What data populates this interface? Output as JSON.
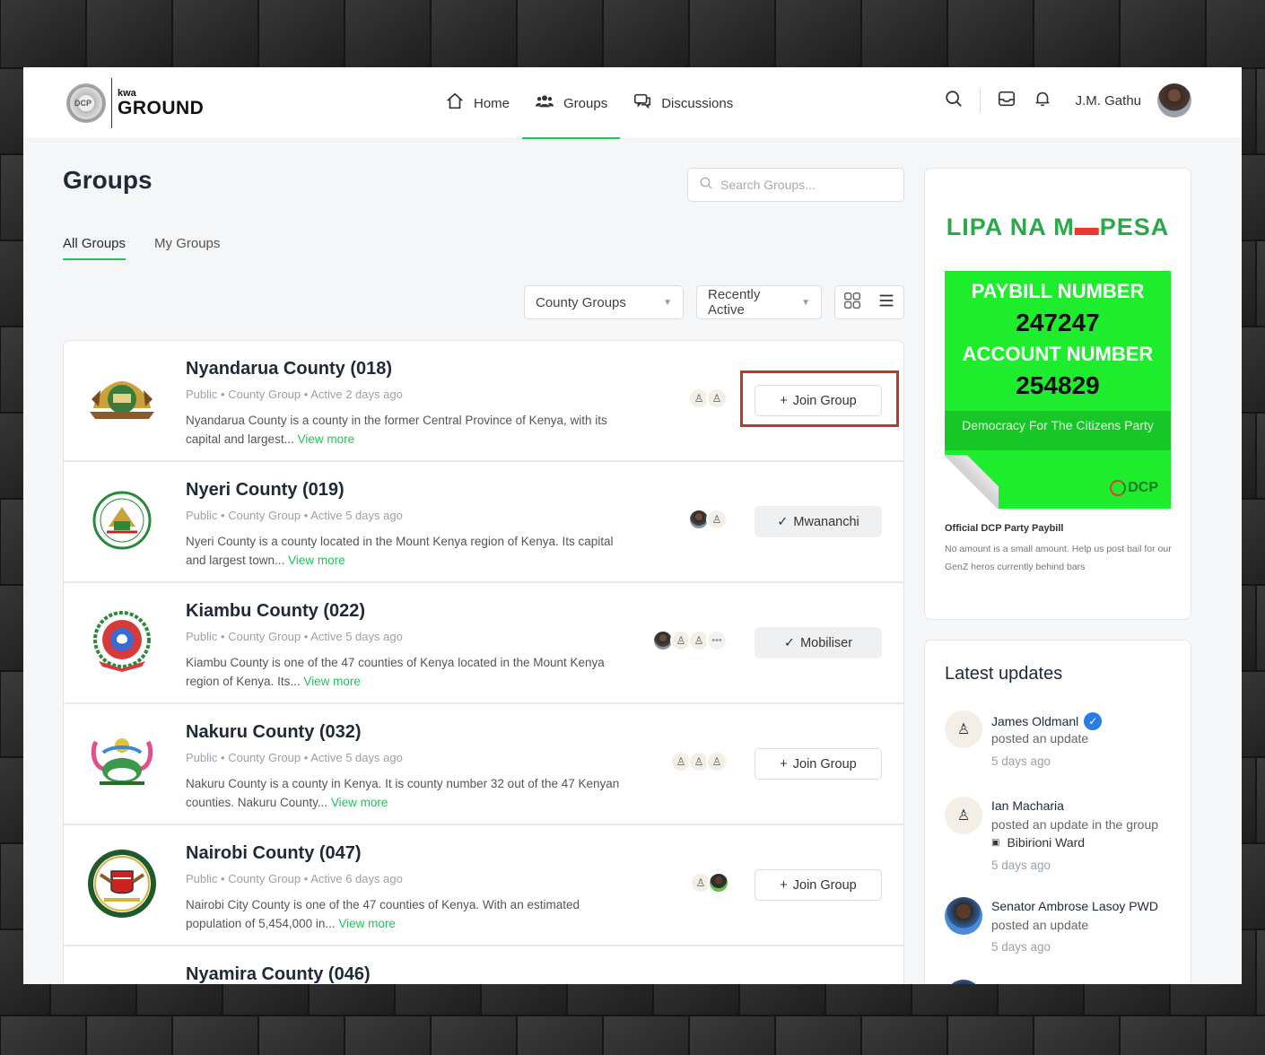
{
  "header": {
    "logo_kwa": "kwa",
    "logo_ground": "GROUND",
    "logo_seal": "DCP",
    "nav": [
      {
        "label": "Home",
        "icon": "home-icon"
      },
      {
        "label": "Groups",
        "icon": "users-icon"
      },
      {
        "label": "Discussions",
        "icon": "chat-icon"
      }
    ],
    "user_name": "J.M. Gathu"
  },
  "main": {
    "title": "Groups",
    "search_placeholder": "Search Groups...",
    "tabs": [
      "All Groups",
      "My Groups"
    ],
    "filter_type": "County Groups",
    "filter_sort": "Recently Active",
    "groups": [
      {
        "name": "Nyandarua County (018)",
        "visibility": "Public",
        "type": "County Group",
        "active": "Active 2 days ago",
        "desc": "Nyandarua County is a county in the former Central Province of Kenya, with its capital and largest...",
        "view_more": "View more",
        "action": "Join Group"
      },
      {
        "name": "Nyeri County (019)",
        "visibility": "Public",
        "type": "County Group",
        "active": "Active 5 days ago",
        "desc": "Nyeri County is a county located in the Mount Kenya region of Kenya. Its capital and largest town...",
        "view_more": "View more",
        "action": "Mwananchi"
      },
      {
        "name": "Kiambu County (022)",
        "visibility": "Public",
        "type": "County Group",
        "active": "Active 5 days ago",
        "desc": "Kiambu County is one of the 47 counties of Kenya located in the Mount Kenya region of Kenya. Its...",
        "view_more": "View more",
        "action": "Mobiliser"
      },
      {
        "name": "Nakuru County (032)",
        "visibility": "Public",
        "type": "County Group",
        "active": "Active 5 days ago",
        "desc": "Nakuru County is a county in Kenya. It is county number 32 out of the 47 Kenyan counties. Nakuru County...",
        "view_more": "View more",
        "action": "Join Group"
      },
      {
        "name": "Nairobi County (047)",
        "visibility": "Public",
        "type": "County Group",
        "active": "Active 6 days ago",
        "desc": "Nairobi City County is one of the 47 counties of Kenya. With an estimated population of 5,454,000 in...",
        "view_more": "View more",
        "action": "Join Group"
      },
      {
        "name": "Nyamira County (046)"
      }
    ]
  },
  "ad": {
    "title_left": "LIPA NA M",
    "title_right": "PESA",
    "paybill_label": "PAYBILL NUMBER",
    "paybill_number": "247247",
    "account_label": "ACCOUNT NUMBER",
    "account_number": "254829",
    "band_text": "Democracy For The Citizens Party",
    "brand": "DCP",
    "caption": "Official DCP Party Paybill",
    "note": "No amount is a small amount. Help us post bail for our GenZ heros currently behind bars"
  },
  "updates": {
    "title": "Latest updates",
    "items": [
      {
        "name": "James Oldmanl",
        "action": "posted an update",
        "time": "5 days ago"
      },
      {
        "name": "Ian Macharia",
        "action": "posted an update in the group",
        "group": "Bibirioni Ward",
        "time": "5 days ago"
      },
      {
        "name": "Senator Ambrose Lasoy PWD",
        "action": "posted an update",
        "time": "5 days ago"
      }
    ]
  },
  "colors": {
    "accent": "#21c35c",
    "highlight": "#b83a2a",
    "mpesa_green": "#1eed2e"
  }
}
